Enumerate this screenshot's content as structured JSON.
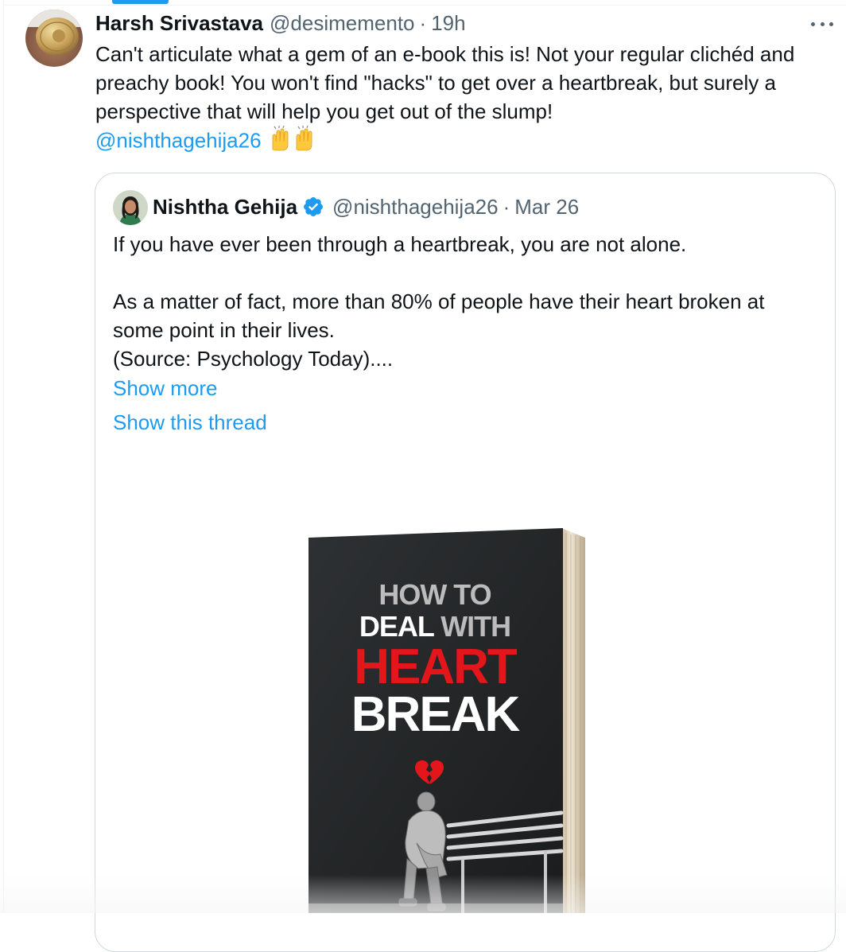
{
  "tweet": {
    "author": {
      "display_name": "Harsh Srivastava",
      "handle": "@desimemento",
      "separator": "·",
      "time": "19h"
    },
    "text": "Can't articulate what a gem of an e-book this is! Not your regular clichéd and preachy book! You won't find \"hacks\" to get over a heartbreak, but surely a perspective that will help you get out of the slump!",
    "mention": "@nishthagehija26",
    "emoji": "🙌🙌",
    "more_icon": "more-horizontal-icon"
  },
  "quoted_tweet": {
    "author": {
      "display_name": "Nishtha Gehija",
      "verified_icon": "verified-badge-icon",
      "handle": "@nishthagehija26",
      "separator": "·",
      "time": "Mar 26"
    },
    "lines": [
      "If you have ever been through a heartbreak, you are not alone.",
      "As a matter of fact, more than 80% of people have their heart broken at some point in their lives.",
      "(Source: Psychology Today)...."
    ],
    "show_more": "Show more",
    "show_thread": "Show this thread",
    "media": {
      "book_title_1": "HOW TO",
      "book_title_2a": "DEAL",
      "book_title_2b": "WITH",
      "book_title_3": "HEART",
      "book_title_4": "BREAK"
    }
  },
  "colors": {
    "link": "#1d9bf0",
    "secondary_text": "#536471",
    "border": "#cfd9de",
    "book_red": "#e3161b"
  }
}
